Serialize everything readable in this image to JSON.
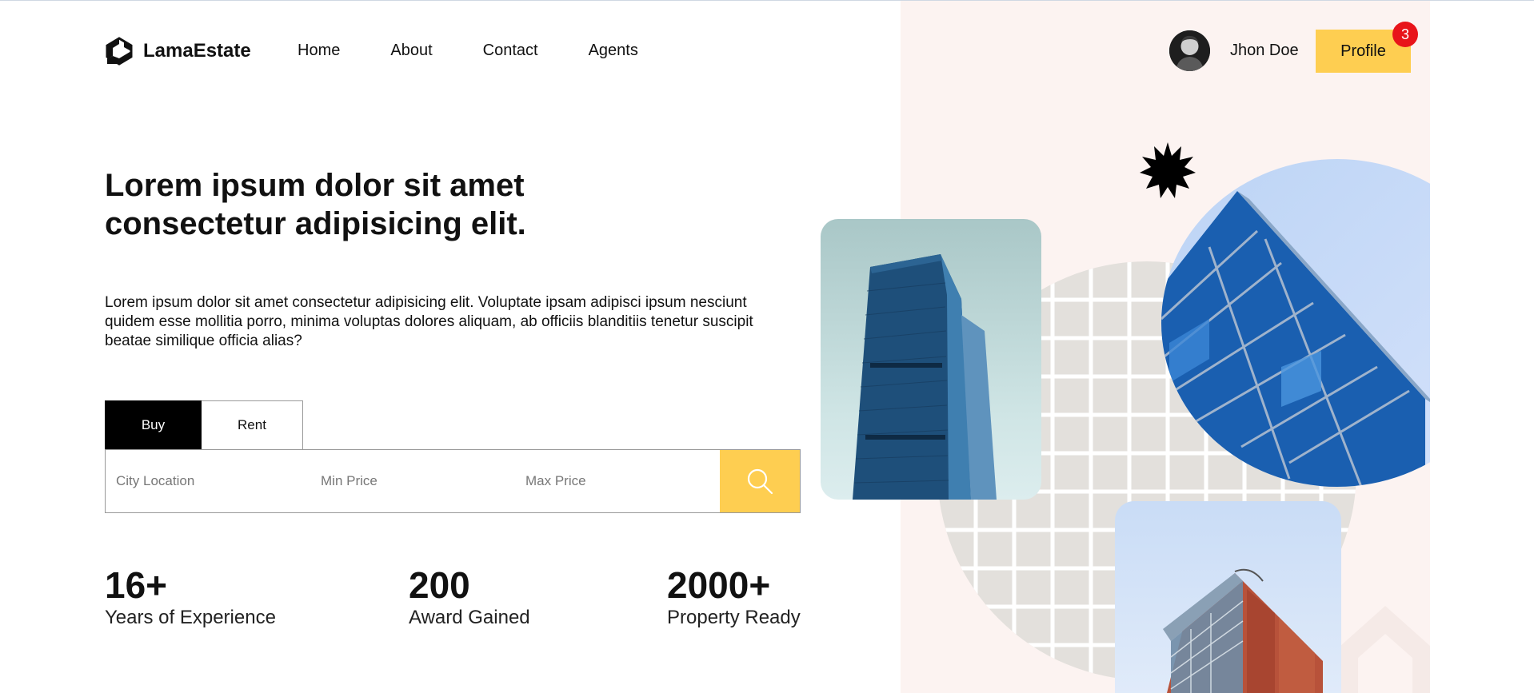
{
  "brand": {
    "name": "LamaEstate",
    "logo_icon": "logo-icon"
  },
  "nav": {
    "items": [
      "Home",
      "About",
      "Contact",
      "Agents"
    ]
  },
  "user": {
    "name": "Jhon Doe",
    "profile_label": "Profile",
    "notification_count": "3"
  },
  "hero": {
    "title": "Lorem ipsum dolor sit amet consectetur adipisicing elit.",
    "description": "Lorem ipsum dolor sit amet consectetur adipisicing elit. Voluptate ipsam adipisci ipsum nesciunt quidem esse mollitia porro, minima voluptas dolores aliquam, ab officiis blanditiis tenetur suscipit beatae similique officia alias?"
  },
  "search": {
    "tabs": [
      "Buy",
      "Rent"
    ],
    "active_tab": "Buy",
    "fields": {
      "city": {
        "placeholder": "City Location",
        "value": ""
      },
      "min_price": {
        "placeholder": "Min Price",
        "value": ""
      },
      "max_price": {
        "placeholder": "Max Price",
        "value": ""
      }
    },
    "button_icon": "search-icon"
  },
  "stats": [
    {
      "number": "16+",
      "label": "Years of Experience"
    },
    {
      "number": "200",
      "label": "Award Gained"
    },
    {
      "number": "2000+",
      "label": "Property Ready"
    }
  ],
  "colors": {
    "accent": "#fece51",
    "badge": "#e8141a",
    "right_panel": "#fcf3f1",
    "active_tab": "#000000"
  }
}
